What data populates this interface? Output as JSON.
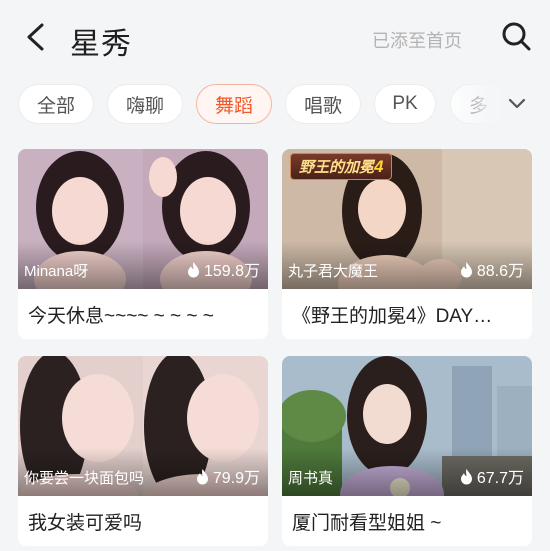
{
  "header": {
    "back_icon": "chevron-left-icon",
    "title": "星秀",
    "added_label": "已添至首页",
    "search_icon": "search-icon"
  },
  "tabs": [
    {
      "label": "全部",
      "active": false
    },
    {
      "label": "嗨聊",
      "active": false
    },
    {
      "label": "舞蹈",
      "active": true
    },
    {
      "label": "唱歌",
      "active": false
    },
    {
      "label": "PK",
      "active": false
    },
    {
      "label": "多",
      "active": false
    }
  ],
  "tab_more_icon": "chevron-down-icon",
  "cards": [
    {
      "streamer": "Minana呀",
      "views": "159.8万",
      "title": "今天休息~~~~ ~ ~ ~ ~"
    },
    {
      "streamer": "丸子君大魔王",
      "views": "88.6万",
      "title": "《野王的加冕4》DAY…",
      "badge_text": "野王的加冕",
      "badge_num": "4"
    },
    {
      "streamer": "你要尝一块面包吗",
      "views": "79.9万",
      "title": "我女装可爱吗"
    },
    {
      "streamer": "周书真",
      "views": "67.7万",
      "title": "厦门耐看型姐姐 ~"
    }
  ],
  "colors": {
    "accent": "#f05a2a",
    "active_tab_bg": "#fff6f3",
    "page_bg": "#f4f5f7"
  },
  "icons": {
    "views": "fire-icon"
  }
}
